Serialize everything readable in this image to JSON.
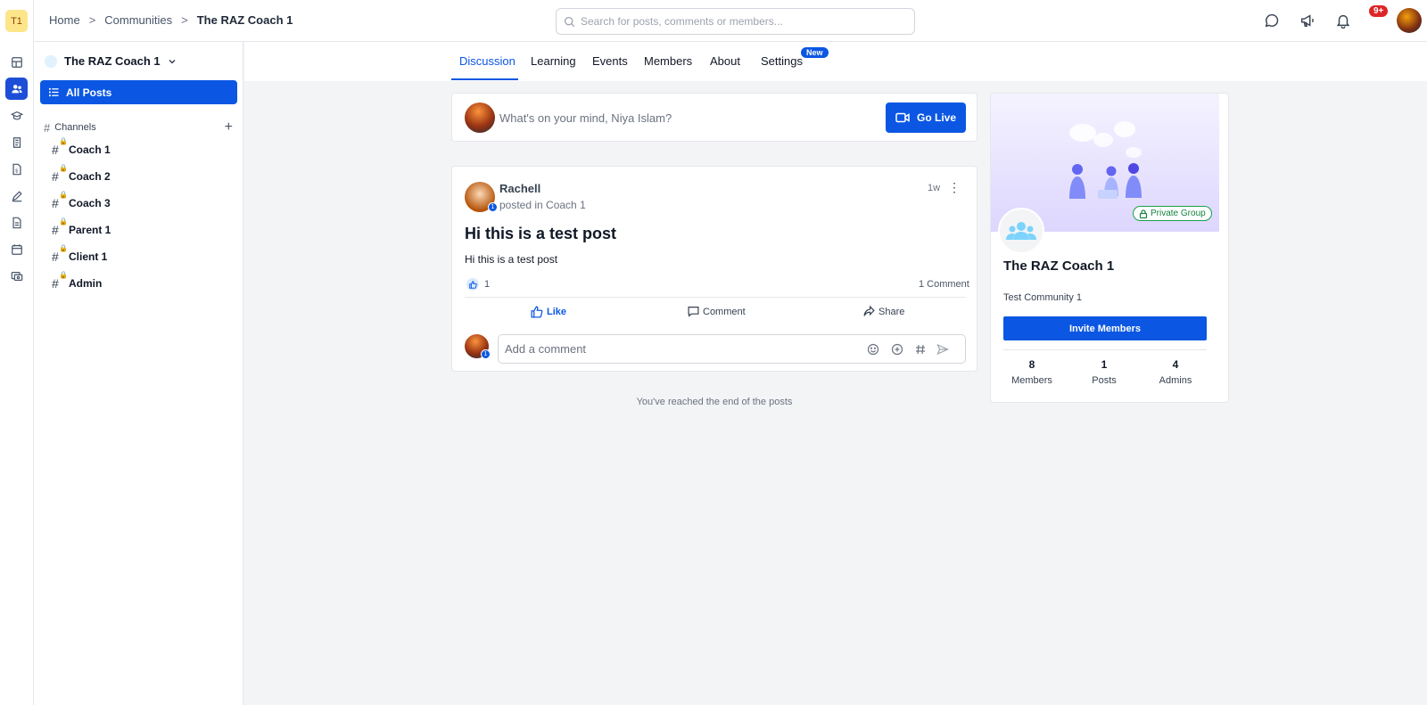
{
  "workspace": {
    "initials": "T1"
  },
  "breadcrumb": {
    "home": "Home",
    "sep1": ">",
    "communities": "Communities",
    "sep2": ">",
    "current": "The RAZ Coach 1"
  },
  "search": {
    "placeholder": "Search for posts, comments or members..."
  },
  "header": {
    "notifications_badge": "9+"
  },
  "sidebar": {
    "community_name": "The RAZ Coach 1",
    "all_posts_label": "All Posts",
    "channels_label": "Channels",
    "channels": [
      {
        "label": "Coach 1"
      },
      {
        "label": "Coach 2"
      },
      {
        "label": "Coach 3"
      },
      {
        "label": "Parent 1"
      },
      {
        "label": "Client 1"
      },
      {
        "label": "Admin"
      }
    ]
  },
  "tabs": [
    {
      "label": "Discussion"
    },
    {
      "label": "Learning"
    },
    {
      "label": "Events"
    },
    {
      "label": "Members"
    },
    {
      "label": "About"
    },
    {
      "label": "Settings",
      "badge": "New"
    }
  ],
  "composer": {
    "prompt": "What's on your mind, Niya Islam?",
    "go_live_label": "Go Live"
  },
  "post": {
    "author": "Rachell",
    "author_level": "1",
    "posted_in_prefix": "posted in",
    "channel": "Coach 1",
    "time": "1w",
    "title": "Hi this is a test post",
    "body": "Hi this is a test post",
    "like_count": "1",
    "comment_count": "1 Comment",
    "actions": {
      "like": "Like",
      "comment": "Comment",
      "share": "Share"
    },
    "comment_placeholder": "Add a comment",
    "viewer_level": "1"
  },
  "end_message": "You've reached the end of the posts",
  "community_card": {
    "privacy": "Private Group",
    "title": "The RAZ Coach 1",
    "description": "Test Community 1",
    "invite_label": "Invite Members",
    "stats": [
      {
        "value": "8",
        "label": "Members"
      },
      {
        "value": "1",
        "label": "Posts"
      },
      {
        "value": "4",
        "label": "Admins"
      }
    ]
  },
  "colors": {
    "accent": "#0b57e3",
    "private_badge": "#16a34a",
    "notification": "#dc2626"
  }
}
